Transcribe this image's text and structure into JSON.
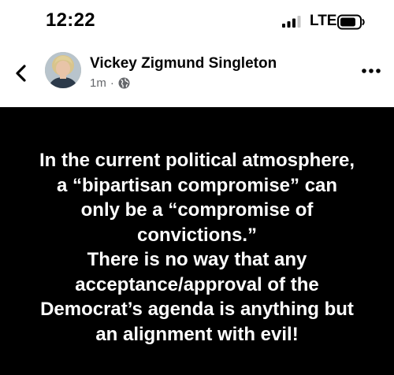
{
  "status_bar": {
    "time": "12:22",
    "network": "LTE",
    "signal_bars_active": 3,
    "signal_bars_total": 4
  },
  "post": {
    "author": "Vickey Zigmund Singleton",
    "timestamp": "1m",
    "separator": "·",
    "privacy_icon": "globe-icon",
    "background_color": "#000000",
    "text_color": "#ffffff",
    "text_lines": [
      "In the current political atmosphere,",
      "a “bipartisan compromise” can",
      "only be a “compromise of",
      "convictions.”",
      "There is no way that any",
      "acceptance/approval of the",
      "Democrat’s agenda is anything but",
      "an alignment with evil!"
    ]
  },
  "icons": {
    "back": "chevron-left-icon",
    "more": "more-horizontal-icon",
    "battery": "battery-icon",
    "signal": "signal-icon"
  }
}
